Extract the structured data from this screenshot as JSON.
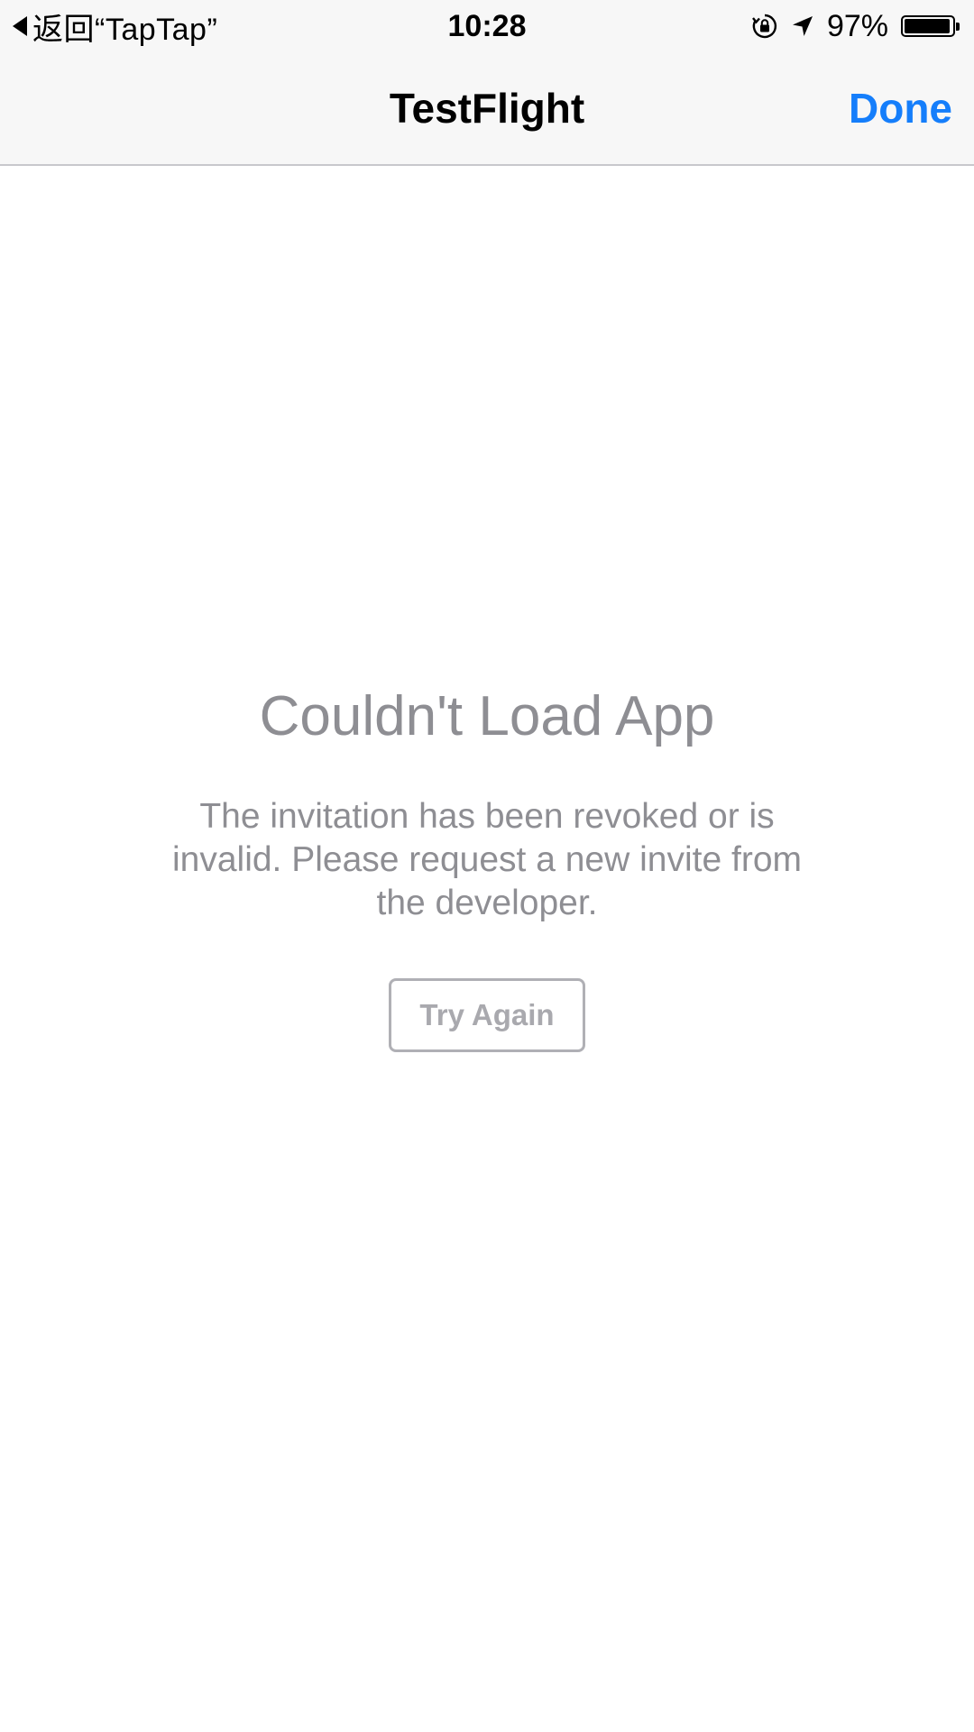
{
  "status_bar": {
    "back_app_label": "返回“TapTap”",
    "time": "10:28",
    "battery_percent_label": "97%",
    "battery_level": 0.97,
    "icons": [
      "back-triangle-icon",
      "rotation-lock-icon",
      "location-arrow-icon",
      "battery-icon"
    ]
  },
  "nav": {
    "title": "TestFlight",
    "done_label": "Done"
  },
  "error": {
    "title": "Couldn't Load App",
    "message": "The invitation has been revoked or is invalid. Please request a new invite from the developer.",
    "button_label": "Try Again"
  },
  "colors": {
    "accent": "#157efb",
    "secondary_text": "#8e8e93",
    "bar_background": "#f7f7f7"
  }
}
